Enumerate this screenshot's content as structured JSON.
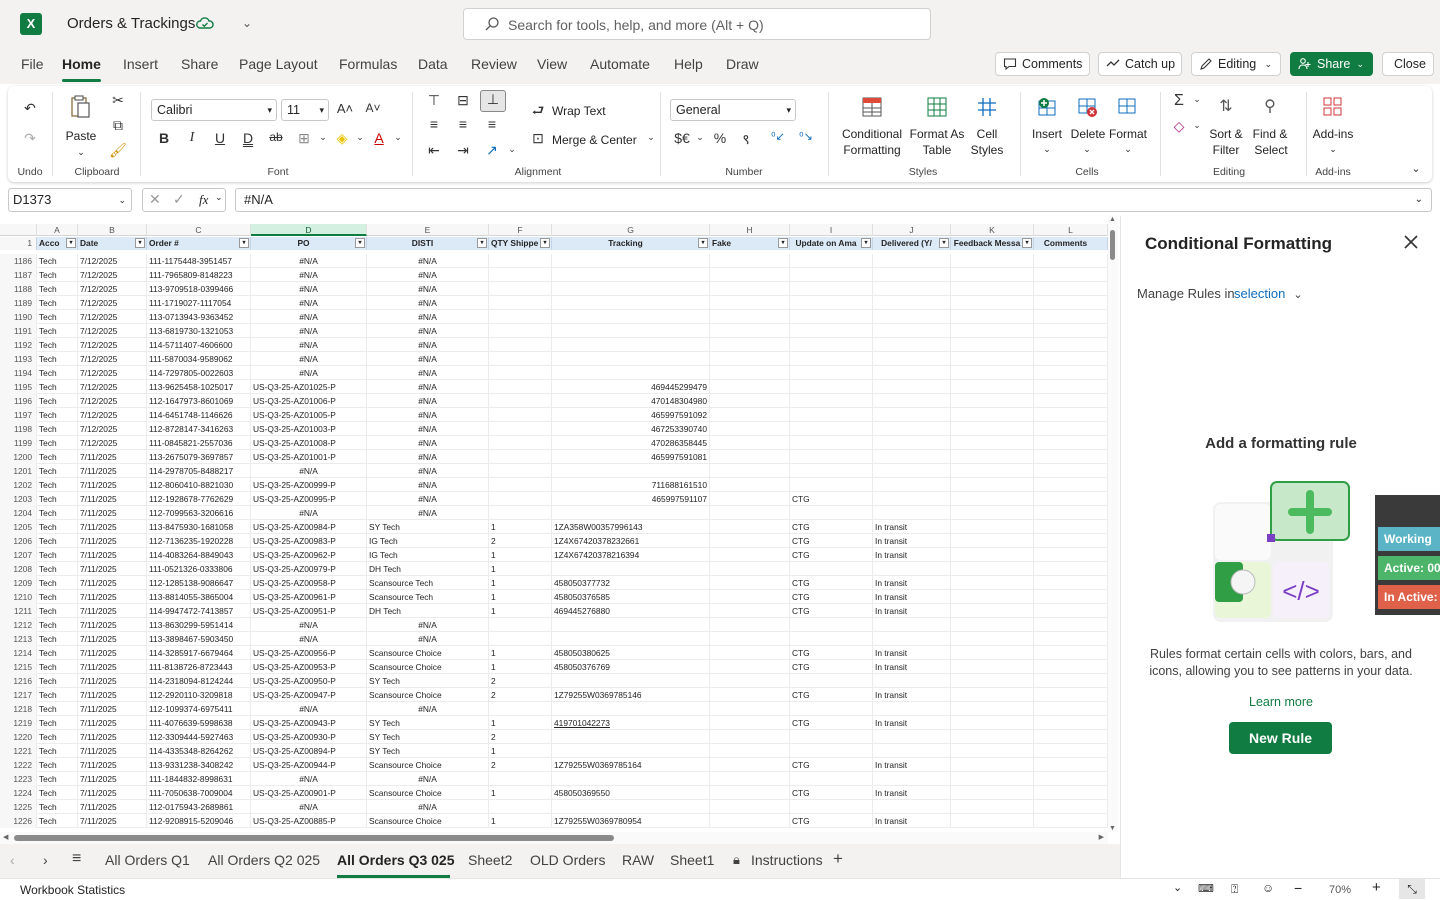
{
  "app": {
    "title": "Orders & Trackings",
    "search_placeholder": "Search for tools, help, and more (Alt + Q)"
  },
  "menu": [
    "File",
    "Home",
    "Insert",
    "Share",
    "Page Layout",
    "Formulas",
    "Data",
    "Review",
    "View",
    "Automate",
    "Help",
    "Draw"
  ],
  "top_buttons": {
    "comments": "Comments",
    "catchup": "Catch up",
    "editing": "Editing",
    "share": "Share",
    "close": "Close"
  },
  "ribbon": {
    "undo_label": "Undo",
    "paste": "Paste",
    "clipboard": "Clipboard",
    "font_name": "Calibri",
    "font_size": "11",
    "font": "Font",
    "wrap_text": "Wrap Text",
    "merge_center": "Merge & Center",
    "alignment": "Alignment",
    "number_format": "General",
    "number": "Number",
    "cond_fmt_1": "Conditional",
    "cond_fmt_2": "Formatting",
    "fmt_table_1": "Format As",
    "fmt_table_2": "Table",
    "cell_styles_1": "Cell",
    "cell_styles_2": "Styles",
    "styles": "Styles",
    "insert": "Insert",
    "delete": "Delete",
    "format": "Format",
    "cells": "Cells",
    "sort_1": "Sort &",
    "sort_2": "Filter",
    "find_1": "Find &",
    "find_2": "Select",
    "editing": "Editing",
    "addins": "Add-ins",
    "addins_group": "Add-ins"
  },
  "formula_bar": {
    "name_box": "D1373",
    "formula": "#N/A"
  },
  "columns": [
    {
      "letter": "A",
      "header": "Acco"
    },
    {
      "letter": "B",
      "header": "Date"
    },
    {
      "letter": "C",
      "header": "Order #"
    },
    {
      "letter": "D",
      "header": "PO"
    },
    {
      "letter": "E",
      "header": "DISTI"
    },
    {
      "letter": "F",
      "header": "QTY Shippe"
    },
    {
      "letter": "G",
      "header": "Tracking"
    },
    {
      "letter": "H",
      "header": "Fake"
    },
    {
      "letter": "I",
      "header": "Update on Ama"
    },
    {
      "letter": "J",
      "header": "Delivered (Y/"
    },
    {
      "letter": "K",
      "header": "Feedback Messa"
    },
    {
      "letter": "L",
      "header": "Comments"
    }
  ],
  "header_row_num": "1",
  "rows": [
    [
      "1186",
      "Tech",
      "7/12/2025",
      "111-1175448-3951457",
      "#N/A",
      "#N/A",
      "",
      "",
      "",
      "",
      "",
      "",
      ""
    ],
    [
      "1187",
      "Tech",
      "7/12/2025",
      "111-7965809-8148223",
      "#N/A",
      "#N/A",
      "",
      "",
      "",
      "",
      "",
      "",
      ""
    ],
    [
      "1188",
      "Tech",
      "7/12/2025",
      "113-9709518-0399466",
      "#N/A",
      "#N/A",
      "",
      "",
      "",
      "",
      "",
      "",
      ""
    ],
    [
      "1189",
      "Tech",
      "7/12/2025",
      "111-1719027-1117054",
      "#N/A",
      "#N/A",
      "",
      "",
      "",
      "",
      "",
      "",
      ""
    ],
    [
      "1190",
      "Tech",
      "7/12/2025",
      "113-0713943-9363452",
      "#N/A",
      "#N/A",
      "",
      "",
      "",
      "",
      "",
      "",
      ""
    ],
    [
      "1191",
      "Tech",
      "7/12/2025",
      "113-6819730-1321053",
      "#N/A",
      "#N/A",
      "",
      "",
      "",
      "",
      "",
      "",
      ""
    ],
    [
      "1192",
      "Tech",
      "7/12/2025",
      "114-5711407-4606600",
      "#N/A",
      "#N/A",
      "",
      "",
      "",
      "",
      "",
      "",
      ""
    ],
    [
      "1193",
      "Tech",
      "7/12/2025",
      "111-5870034-9589062",
      "#N/A",
      "#N/A",
      "",
      "",
      "",
      "",
      "",
      "",
      ""
    ],
    [
      "1194",
      "Tech",
      "7/12/2025",
      "114-7297805-0022603",
      "#N/A",
      "#N/A",
      "",
      "",
      "",
      "",
      "",
      "",
      ""
    ],
    [
      "1195",
      "Tech",
      "7/12/2025",
      "113-9625458-1025017",
      "US-Q3-25-AZ01025-P",
      "#N/A",
      "",
      "469445299479",
      "",
      "",
      "",
      "",
      ""
    ],
    [
      "1196",
      "Tech",
      "7/12/2025",
      "112-1647973-8601069",
      "US-Q3-25-AZ01006-P",
      "#N/A",
      "",
      "470148304980",
      "",
      "",
      "",
      "",
      ""
    ],
    [
      "1197",
      "Tech",
      "7/12/2025",
      "114-6451748-1146626",
      "US-Q3-25-AZ01005-P",
      "#N/A",
      "",
      "465997591092",
      "",
      "",
      "",
      "",
      ""
    ],
    [
      "1198",
      "Tech",
      "7/12/2025",
      "112-8728147-3416263",
      "US-Q3-25-AZ01003-P",
      "#N/A",
      "",
      "467253390740",
      "",
      "",
      "",
      "",
      ""
    ],
    [
      "1199",
      "Tech",
      "7/12/2025",
      "111-0845821-2557036",
      "US-Q3-25-AZ01008-P",
      "#N/A",
      "",
      "470286358445",
      "",
      "",
      "",
      "",
      ""
    ],
    [
      "1200",
      "Tech",
      "7/11/2025",
      "113-2675079-3697857",
      "US-Q3-25-AZ01001-P",
      "#N/A",
      "",
      "465997591081",
      "",
      "",
      "",
      "",
      ""
    ],
    [
      "1201",
      "Tech",
      "7/11/2025",
      "114-2978705-8488217",
      "#N/A",
      "#N/A",
      "",
      "",
      "",
      "",
      "",
      "",
      ""
    ],
    [
      "1202",
      "Tech",
      "7/11/2025",
      "112-8060410-8821030",
      "US-Q3-25-AZ00999-P",
      "#N/A",
      "",
      "711688161510",
      "",
      "",
      "",
      "",
      ""
    ],
    [
      "1203",
      "Tech",
      "7/11/2025",
      "112-1928678-7762629",
      "US-Q3-25-AZ00995-P",
      "#N/A",
      "",
      "465997591107",
      "",
      "CTG",
      "",
      "",
      ""
    ],
    [
      "1204",
      "Tech",
      "7/11/2025",
      "112-7099563-3206616",
      "#N/A",
      "#N/A",
      "",
      "",
      "",
      "",
      "",
      "",
      ""
    ],
    [
      "1205",
      "Tech",
      "7/11/2025",
      "113-8475930-1681058",
      "US-Q3-25-AZ00984-P",
      "SY Tech",
      "1",
      "1ZA358W00357996143",
      "",
      "CTG",
      "In transit",
      "",
      ""
    ],
    [
      "1206",
      "Tech",
      "7/11/2025",
      "112-7136235-1920228",
      "US-Q3-25-AZ00983-P",
      "IG Tech",
      "2",
      "1Z4X67420378232661",
      "",
      "CTG",
      "In transit",
      "",
      ""
    ],
    [
      "1207",
      "Tech",
      "7/11/2025",
      "114-4083264-8849043",
      "US-Q3-25-AZ00962-P",
      "IG Tech",
      "1",
      "1Z4X67420378216394",
      "",
      "CTG",
      "In transit",
      "",
      ""
    ],
    [
      "1208",
      "Tech",
      "7/11/2025",
      "111-0521326-0333806",
      "US-Q3-25-AZ00979-P",
      "DH Tech",
      "1",
      "",
      "",
      "",
      "",
      "",
      ""
    ],
    [
      "1209",
      "Tech",
      "7/11/2025",
      "112-1285138-9086647",
      "US-Q3-25-AZ00958-P",
      "Scansource Tech",
      "1",
      "458050377732",
      "",
      "CTG",
      "In transit",
      "",
      ""
    ],
    [
      "1210",
      "Tech",
      "7/11/2025",
      "113-8814055-3865004",
      "US-Q3-25-AZ00961-P",
      "Scansource Tech",
      "1",
      "458050376585",
      "",
      "CTG",
      "In transit",
      "",
      ""
    ],
    [
      "1211",
      "Tech",
      "7/11/2025",
      "114-9947472-7413857",
      "US-Q3-25-AZ00951-P",
      "DH Tech",
      "1",
      "469445276880",
      "",
      "CTG",
      "In transit",
      "",
      ""
    ],
    [
      "1212",
      "Tech",
      "7/11/2025",
      "113-8630299-5951414",
      "#N/A",
      "#N/A",
      "",
      "",
      "",
      "",
      "",
      "",
      ""
    ],
    [
      "1213",
      "Tech",
      "7/11/2025",
      "113-3898467-5903450",
      "#N/A",
      "#N/A",
      "",
      "",
      "",
      "",
      "",
      "",
      ""
    ],
    [
      "1214",
      "Tech",
      "7/11/2025",
      "114-3285917-6679464",
      "US-Q3-25-AZ00956-P",
      "Scansource Choice",
      "1",
      "458050380625",
      "",
      "CTG",
      "In transit",
      "",
      ""
    ],
    [
      "1215",
      "Tech",
      "7/11/2025",
      "111-8138726-8723443",
      "US-Q3-25-AZ00953-P",
      "Scansource Choice",
      "1",
      "458050376769",
      "",
      "CTG",
      "In transit",
      "",
      ""
    ],
    [
      "1216",
      "Tech",
      "7/11/2025",
      "114-2318094-8124244",
      "US-Q3-25-AZ00950-P",
      "SY Tech",
      "2",
      "",
      "",
      "",
      "",
      "",
      ""
    ],
    [
      "1217",
      "Tech",
      "7/11/2025",
      "112-2920110-3209818",
      "US-Q3-25-AZ00947-P",
      "Scansource Choice",
      "2",
      "1Z79255W0369785146",
      "",
      "CTG",
      "In transit",
      "",
      ""
    ],
    [
      "1218",
      "Tech",
      "7/11/2025",
      "112-1099374-6975411",
      "#N/A",
      "#N/A",
      "",
      "",
      "",
      "",
      "",
      "",
      ""
    ],
    [
      "1219",
      "Tech",
      "7/11/2025",
      "111-4076639-5998638",
      "US-Q3-25-AZ00943-P",
      "SY Tech",
      "1",
      "419701042273",
      "",
      "CTG",
      "In transit",
      "",
      ""
    ],
    [
      "1220",
      "Tech",
      "7/11/2025",
      "112-3309444-5927463",
      "US-Q3-25-AZ00930-P",
      "SY Tech",
      "2",
      "",
      "",
      "",
      "",
      "",
      ""
    ],
    [
      "1221",
      "Tech",
      "7/11/2025",
      "114-4335348-8264262",
      "US-Q3-25-AZ00894-P",
      "SY Tech",
      "1",
      "",
      "",
      "",
      "",
      "",
      ""
    ],
    [
      "1222",
      "Tech",
      "7/11/2025",
      "113-9331238-3408242",
      "US-Q3-25-AZ00944-P",
      "Scansource Choice",
      "2",
      "1Z79255W0369785164",
      "",
      "CTG",
      "In transit",
      "",
      ""
    ],
    [
      "1223",
      "Tech",
      "7/11/2025",
      "111-1844832-8998631",
      "#N/A",
      "#N/A",
      "",
      "",
      "",
      "",
      "",
      "",
      ""
    ],
    [
      "1224",
      "Tech",
      "7/11/2025",
      "111-7050638-7009004",
      "US-Q3-25-AZ00901-P",
      "Scansource Choice",
      "1",
      "458050369550",
      "",
      "CTG",
      "In transit",
      "",
      ""
    ],
    [
      "1225",
      "Tech",
      "7/11/2025",
      "112-0175943-2689861",
      "#N/A",
      "#N/A",
      "",
      "",
      "",
      "",
      "",
      "",
      ""
    ],
    [
      "1226",
      "Tech",
      "7/11/2025",
      "112-9208915-5209046",
      "US-Q3-25-AZ00885-P",
      "Scansource Choice",
      "1",
      "1Z79255W0369780954",
      "",
      "CTG",
      "In transit",
      "",
      ""
    ]
  ],
  "sheets": [
    "All Orders Q1",
    "All Orders Q2 025",
    "All Orders Q3 025",
    "Sheet2",
    "OLD Orders",
    "RAW",
    "Sheet1",
    "Instructions"
  ],
  "active_sheet": "All Orders Q3 025",
  "status": {
    "left": "Workbook Statistics",
    "zoom": "70%"
  },
  "pane": {
    "title": "Conditional Formatting",
    "manage_label": "Manage Rules in",
    "manage_value": "selection",
    "add_title": "Add a formatting rule",
    "description": "Rules format certain cells with colors, bars, and icons, allowing you to see patterns in your data.",
    "learn_more": "Learn more",
    "new_rule": "New Rule",
    "cards": [
      {
        "label": "Working",
        "color": "#5ab4c6"
      },
      {
        "label": "Active: 00",
        "color": "#4cb56a"
      },
      {
        "label": "In Active:",
        "color": "#e0614a"
      }
    ]
  },
  "colors": {
    "accent": "#107c41",
    "link": "#0f6cbd"
  }
}
